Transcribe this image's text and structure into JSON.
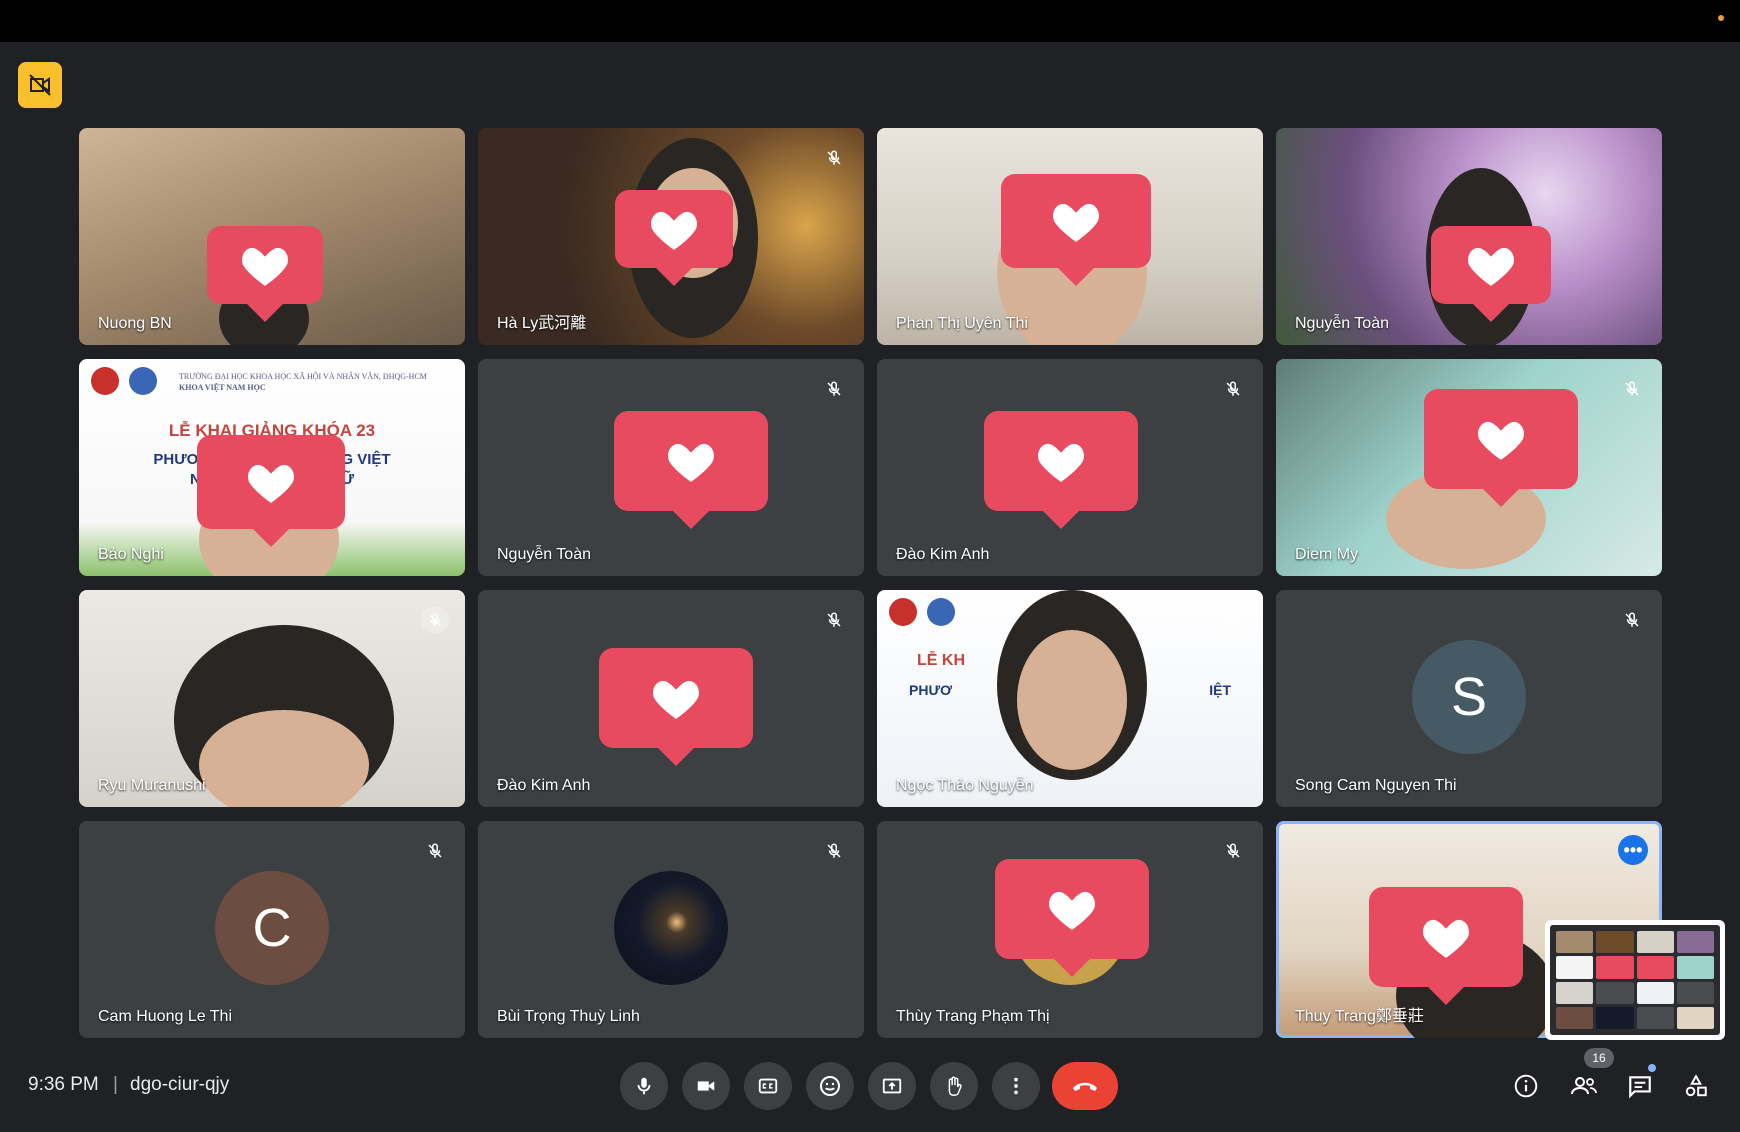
{
  "meeting": {
    "time": "9:36 PM",
    "separator": "|",
    "code": "dgo-ciur-qjy",
    "participant_count": "16"
  },
  "participants": [
    {
      "name": "Nuong BN",
      "muted": false
    },
    {
      "name": "Hà Ly武河離",
      "muted": true
    },
    {
      "name": "Phan Thị Uyên Thi",
      "muted": false
    },
    {
      "name": "Nguyễn Toàn",
      "muted": false
    },
    {
      "name": "Bảo Nghi",
      "muted": true
    },
    {
      "name": "Nguyễn Toàn",
      "muted": true
    },
    {
      "name": "Đào Kim Anh",
      "muted": true
    },
    {
      "name": "Diem My",
      "muted": true
    },
    {
      "name": "Ryu Muranushi",
      "muted": true
    },
    {
      "name": "Đào Kim Anh",
      "muted": true
    },
    {
      "name": "Ngọc Thảo Nguyễn",
      "muted": true
    },
    {
      "name": "Song Cam Nguyen Thi",
      "muted": true,
      "avatar_letter": "S"
    },
    {
      "name": "Cam Huong Le Thi",
      "muted": true,
      "avatar_letter": "C"
    },
    {
      "name": "Bùi Trọng Thuỳ Linh",
      "muted": true
    },
    {
      "name": "Thùy Trang Phạm Thị",
      "muted": true
    },
    {
      "name": "Thuy Trang鄭垂莊",
      "muted": false,
      "active": true
    }
  ],
  "slides": {
    "header_line1": "TRƯỜNG ĐẠI HỌC KHOA HỌC XÃ HỘI VÀ NHÂN VĂN, ĐHQG-HCM",
    "header_line2": "KHOA VIỆT NAM HỌC",
    "title": "LỄ KHAI GIẢNG KHÓA 23",
    "subtitle_line1": "PHƯƠNG PHÁP DẠY TIẾNG VIỆT",
    "subtitle_line2": "NHƯ MỘT NGOẠI NGỮ",
    "title_short": "LỄ KH",
    "subtitle_short_left": "PHƯƠ",
    "subtitle_short_right": "IỆT"
  },
  "icons": {
    "recording": "camera-off-icon",
    "mic": "mic-icon",
    "camera": "videocam-icon",
    "captions": "closed-captions-icon",
    "reactions": "emoji-icon",
    "present": "present-screen-icon",
    "hand": "raise-hand-icon",
    "more": "more-vert-icon",
    "end_call": "call-end-icon",
    "info": "info-icon",
    "people": "people-icon",
    "chat": "chat-icon",
    "activities": "activities-icon"
  },
  "colors": {
    "background": "#202124",
    "reaction": "#e84a5f",
    "end_call": "#ea4335",
    "active_border": "#8ab4f8",
    "recording_badge": "#f9c02c"
  }
}
